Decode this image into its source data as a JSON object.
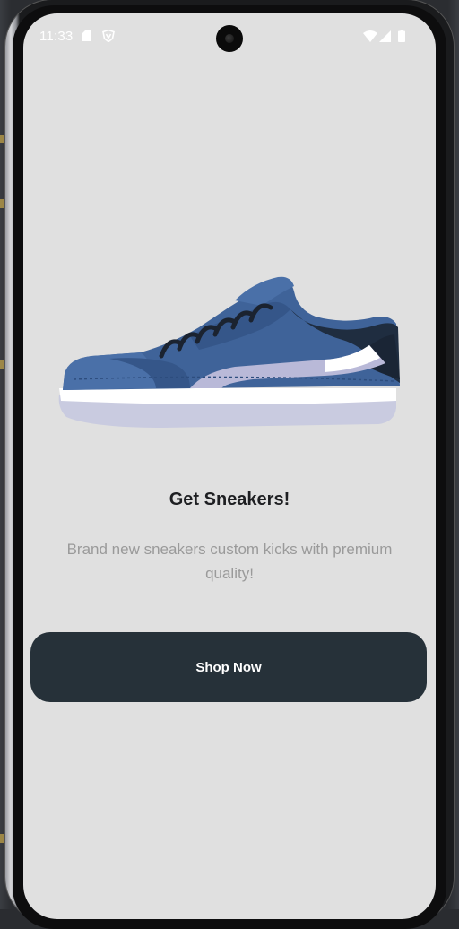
{
  "status_bar": {
    "time": "11:33",
    "icons": [
      "sd-card-icon",
      "shield-icon",
      "wifi-icon",
      "cell-signal-icon",
      "battery-icon"
    ]
  },
  "onboarding": {
    "image": "sneaker-illustration",
    "title": "Get Sneakers!",
    "subtitle": "Brand new sneakers custom kicks with premium quality!",
    "cta_label": "Shop Now"
  },
  "colors": {
    "screen_bg": "#e0e0e0",
    "button_bg": "#263139",
    "button_text": "#ffffff",
    "title_text": "#1e1f22",
    "subtitle_text": "#9a9a9a",
    "shoe_primary": "#3f6399",
    "shoe_dark": "#1f2d40",
    "shoe_accent": "#b9b9d8",
    "sole": "#c9cbe0"
  }
}
